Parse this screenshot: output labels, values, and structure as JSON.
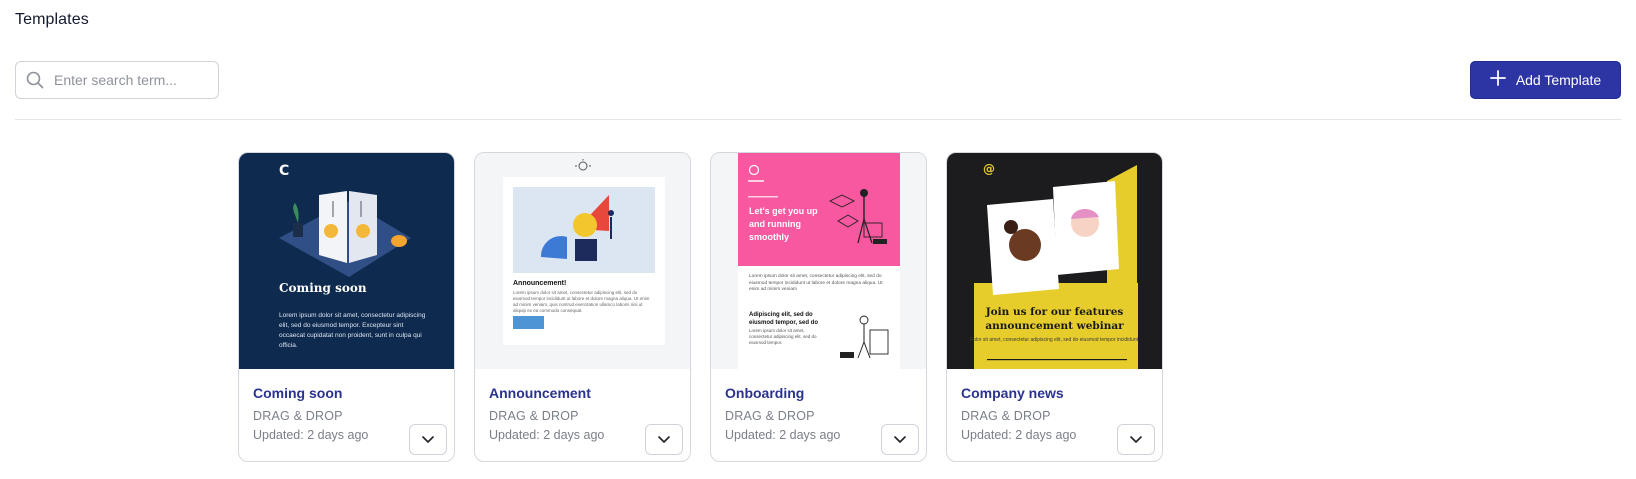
{
  "page": {
    "title": "Templates"
  },
  "search": {
    "placeholder": "Enter search term..."
  },
  "toolbar": {
    "add_label": "Add Template"
  },
  "colors": {
    "accent": "#2d34a4",
    "card_title": "#2a3390"
  },
  "templates": [
    {
      "title": "Coming soon",
      "type": "DRAG & DROP",
      "updated": "Updated: 2 days ago",
      "preview": {
        "heading": "Coming soon",
        "body": "Lorem ipsum dolor sit amet, consectetur adipiscing elit, sed do eiusmod tempor. Excepteur sint occaecat cupidatat non proident, sunt in culpa qui officia."
      }
    },
    {
      "title": "Announcement",
      "type": "DRAG & DROP",
      "updated": "Updated: 2 days ago",
      "preview": {
        "heading": "Announcement!",
        "body": "Lorem ipsum dolor sit amet, consectetur adipiscing elit, sed do eiusmod tempor incididunt ut labore et dolore magna aliqua. Ut enim ad minim veniam, quis nostrud exercitation ullamco laboris nisi ut aliquip ex ea commodo consequat."
      }
    },
    {
      "title": "Onboarding",
      "type": "DRAG & DROP",
      "updated": "Updated: 2 days ago",
      "preview": {
        "heading": "Let's get you up and running smoothly",
        "body": "Lorem ipsum dolor sit amet, consectetur adipiscing elit, sed do eiusmod tempor incididunt ut labore et dolore magna aliqua. Ut enim ad minim veniam",
        "subheading": "Adipiscing elit, sed do eiusmod tempor, sed do",
        "subbody": "Lorem ipsum dolor sit amet, consectetur adipiscing elit, sed do eiusmod tempor."
      }
    },
    {
      "title": "Company news",
      "type": "DRAG & DROP",
      "updated": "Updated: 2 days ago",
      "preview": {
        "heading": "Join us for our features announcement webinar",
        "body": "Dolor sit amet, consectetur adipiscing elit, sed do eiusmod tempor incididunt."
      }
    }
  ]
}
